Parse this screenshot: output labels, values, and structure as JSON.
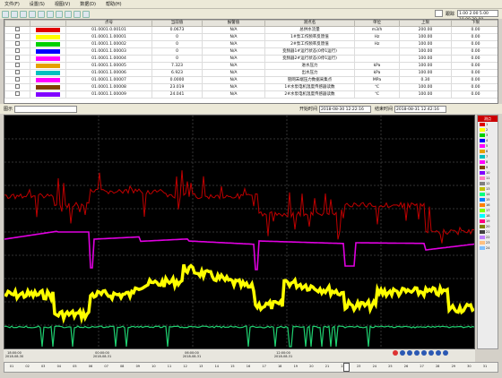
{
  "menu": [
    "文件(F)",
    "设置(S)",
    "视图(V)",
    "数据(D)",
    "帮助(H)"
  ],
  "topright": {
    "label": "跟踪",
    "range_value": "1.00 2.00 5.00 10.00 20.00",
    "caption": ""
  },
  "table": {
    "headers": [
      "",
      "",
      "点号",
      "当前值",
      "报警值",
      "测点名",
      "单位",
      "上限",
      "下限"
    ],
    "rows": [
      {
        "color": "#e00000",
        "point": "01.0001.0.00101",
        "value": "0.0673",
        "alarm": "N/A",
        "name": "总供水流量",
        "unit": "m3/h",
        "upper": "200.00",
        "lower": "0.00"
      },
      {
        "color": "#ffff00",
        "point": "01.0001.1.00001",
        "value": "0",
        "alarm": "N/A",
        "name": "1#泵工作频率反馈值",
        "unit": "Hz",
        "upper": "100.00",
        "lower": "0.00"
      },
      {
        "color": "#00d000",
        "point": "01.0001.1.00002",
        "value": "0",
        "alarm": "N/A",
        "name": "2#泵工作频率反馈值",
        "unit": "Hz",
        "upper": "100.00",
        "lower": "0.00"
      },
      {
        "color": "#0000ff",
        "point": "01.0001.1.00003",
        "value": "0",
        "alarm": "N/A",
        "name": "变频器1#运行状态(0停1运行)",
        "unit": "",
        "upper": "100.00",
        "lower": "0.00"
      },
      {
        "color": "#ff00ff",
        "point": "01.0001.1.00004",
        "value": "0",
        "alarm": "N/A",
        "name": "变频器2#运行状态(0停1运行)",
        "unit": "",
        "upper": "100.00",
        "lower": "0.00"
      },
      {
        "color": "#e6a000",
        "point": "01.0001.1.00005",
        "value": "7.323",
        "alarm": "N/A",
        "name": "进水压力",
        "unit": "kPa",
        "upper": "100.00",
        "lower": "0.00"
      },
      {
        "color": "#00c0c0",
        "point": "01.0001.1.00006",
        "value": "6.923",
        "alarm": "N/A",
        "name": "出水压力",
        "unit": "kPa",
        "upper": "100.00",
        "lower": "0.00"
      },
      {
        "color": "#ff00ff",
        "point": "01.0001.1.00007",
        "value": "0.0000",
        "alarm": "N/A",
        "name": "管网末端压力数据采集点",
        "unit": "MPa",
        "upper": "0.30",
        "lower": "0.00"
      },
      {
        "color": "#804000",
        "point": "01.0001.1.00008",
        "value": "23.019",
        "alarm": "N/A",
        "name": "1#水泵电机温度传感器读数",
        "unit": "℃",
        "upper": "100.00",
        "lower": "0.00"
      },
      {
        "color": "#8000ff",
        "point": "01.0001.1.00009",
        "value": "24.041",
        "alarm": "N/A",
        "name": "2#水泵电机温度传感器读数",
        "unit": "℃",
        "upper": "100.00",
        "lower": "0.00"
      }
    ]
  },
  "midbar": {
    "label": "图示",
    "start_label": "开始时间",
    "start_value": "2018-08-30 12:22:16",
    "end_label": "结束时间",
    "end_value": "2018-08-31 12:42:16"
  },
  "legend": {
    "header": "测点",
    "items": [
      {
        "color": "#e00000",
        "label": "1"
      },
      {
        "color": "#ffff00",
        "label": "2"
      },
      {
        "color": "#00d000",
        "label": "3"
      },
      {
        "color": "#0000ff",
        "label": "4"
      },
      {
        "color": "#ff00ff",
        "label": "5"
      },
      {
        "color": "#e6a000",
        "label": "6"
      },
      {
        "color": "#00c0c0",
        "label": "7"
      },
      {
        "color": "#ff00ff",
        "label": "8"
      },
      {
        "color": "#804000",
        "label": "9"
      },
      {
        "color": "#8000ff",
        "label": "10"
      },
      {
        "color": "#ff80c0",
        "label": "11"
      },
      {
        "color": "#808080",
        "label": "12"
      },
      {
        "color": "#c0c000",
        "label": "13"
      },
      {
        "color": "#00ff80",
        "label": "14"
      },
      {
        "color": "#0080ff",
        "label": "15"
      },
      {
        "color": "#ff8000",
        "label": "16"
      },
      {
        "color": "#80ff00",
        "label": "17"
      },
      {
        "color": "#00ffff",
        "label": "18"
      },
      {
        "color": "#ff0080",
        "label": "19"
      },
      {
        "color": "#808000",
        "label": "20"
      },
      {
        "color": "#404040",
        "label": "21"
      },
      {
        "color": "#c080ff",
        "label": "22"
      },
      {
        "color": "#ffc080",
        "label": "23"
      },
      {
        "color": "#80c0ff",
        "label": "24"
      }
    ]
  },
  "xaxis": {
    "ticks": [
      "18:00:00",
      "00:00:00",
      "06:00:00",
      "12:00:00"
    ],
    "dates": [
      "2018-08-30",
      "2018-08-31",
      "2018-08-31",
      "2018-08-31"
    ]
  },
  "ruler": {
    "ticks": [
      "01",
      "02",
      "03",
      "04",
      "05",
      "06",
      "07",
      "08",
      "09",
      "10",
      "11",
      "12",
      "13",
      "14",
      "15",
      "16",
      "17",
      "18",
      "19",
      "20",
      "21",
      "22",
      "23",
      "24",
      "25",
      "26",
      "27",
      "28",
      "29",
      "30",
      "31"
    ]
  }
}
